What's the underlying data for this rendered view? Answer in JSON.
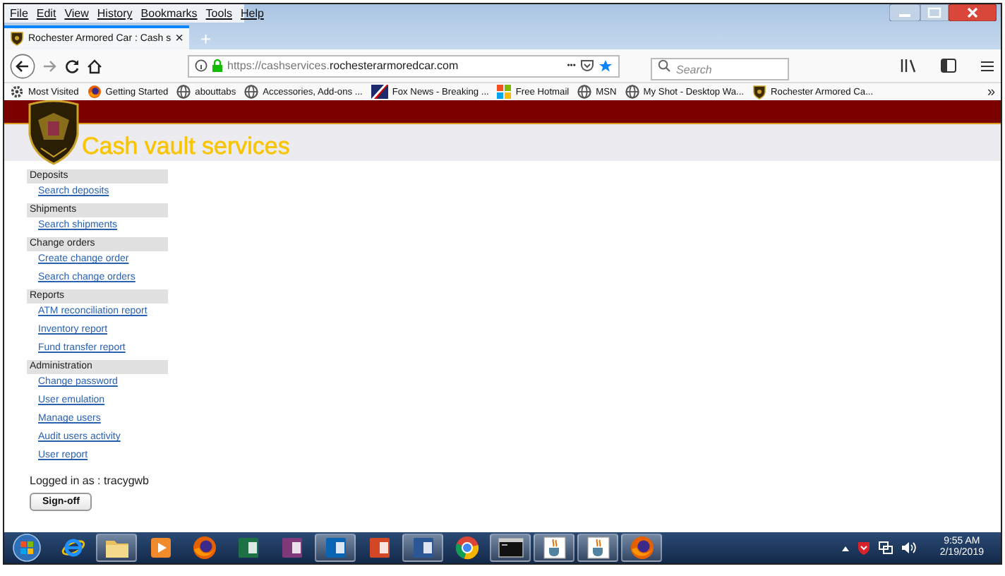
{
  "menu": [
    "File",
    "Edit",
    "View",
    "History",
    "Bookmarks",
    "Tools",
    "Help"
  ],
  "tab": {
    "title": "Rochester Armored Car : Cash s",
    "close": "×",
    "new": "+"
  },
  "address": {
    "url_dim": "https://cashservices.",
    "url_domain": "rochesterarmoredcar.com",
    "more": "•••"
  },
  "search": {
    "placeholder": "Search"
  },
  "bookmarks": [
    {
      "label": "Most Visited",
      "kind": "gear"
    },
    {
      "label": "Getting Started",
      "kind": "firefox"
    },
    {
      "label": "abouttabs",
      "kind": "globe"
    },
    {
      "label": "Accessories, Add-ons ...",
      "kind": "globe"
    },
    {
      "label": "Fox News - Breaking ...",
      "kind": "flag"
    },
    {
      "label": "Free Hotmail",
      "kind": "tiles"
    },
    {
      "label": "MSN",
      "kind": "globe"
    },
    {
      "label": "My Shot - Desktop Wa...",
      "kind": "globe"
    },
    {
      "label": "Rochester Armored Ca...",
      "kind": "shield"
    }
  ],
  "bookmarks_overflow": "»",
  "site": {
    "title": "Cash vault services"
  },
  "sidebar": [
    {
      "heading": "Deposits",
      "links": [
        "Search deposits"
      ]
    },
    {
      "heading": "Shipments",
      "links": [
        "Search shipments"
      ]
    },
    {
      "heading": "Change orders",
      "links": [
        "Create change order",
        "Search change orders"
      ]
    },
    {
      "heading": "Reports",
      "links": [
        "ATM reconciliation report",
        "Inventory report",
        "Fund transfer report"
      ]
    },
    {
      "heading": "Administration",
      "links": [
        "Change password",
        "User emulation",
        "Manage users",
        "Audit users activity",
        "User report"
      ]
    }
  ],
  "logged_in": "Logged in as : tracygwb",
  "sign_off": "Sign-off",
  "taskbar": [
    {
      "kind": "ie",
      "open": false
    },
    {
      "kind": "folder",
      "open": true
    },
    {
      "kind": "media",
      "open": false
    },
    {
      "kind": "firefox",
      "open": false
    },
    {
      "kind": "excel",
      "open": false
    },
    {
      "kind": "onenote",
      "open": false
    },
    {
      "kind": "outlook",
      "open": true
    },
    {
      "kind": "powerpoint",
      "open": false
    },
    {
      "kind": "word",
      "open": true
    },
    {
      "kind": "chrome",
      "open": false
    },
    {
      "kind": "console",
      "open": true
    },
    {
      "kind": "java",
      "open": true
    },
    {
      "kind": "java",
      "open": true
    },
    {
      "kind": "firefox",
      "open": true
    }
  ],
  "clock": {
    "time": "9:55 AM",
    "date": "2/19/2019"
  }
}
